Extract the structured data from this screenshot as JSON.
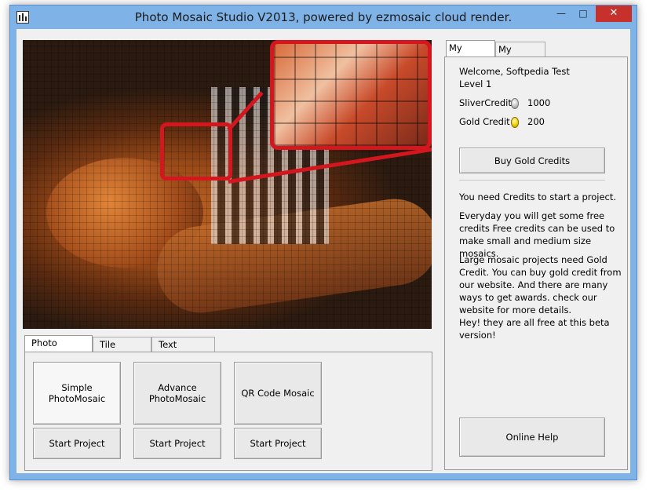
{
  "window": {
    "title": "Photo Mosaic Studio V2013, powered by ezmosaic cloud render.",
    "controls": {
      "minimize": "—",
      "maximize": "□",
      "close": "✕"
    }
  },
  "mosaic_tabs": [
    "Photo Mosaic",
    "Tile Mosaic",
    "Text Mosaic"
  ],
  "mosaic_options": [
    {
      "label": "Simple PhotoMosaic",
      "start": "Start Project"
    },
    {
      "label": "Advance PhotoMosaic",
      "start": "Start Project"
    },
    {
      "label": "QR Code Mosaic",
      "start": "Start Project"
    }
  ],
  "account_tabs": [
    "My account",
    "My Projects"
  ],
  "account": {
    "welcome": "Welcome, Softpedia Test",
    "level": "Level 1",
    "silver_label": "SliverCredit",
    "silver_value": "1000",
    "gold_label": "Gold Credit",
    "gold_value": "200",
    "buy_button": "Buy Gold Credits",
    "note1": "You need Credits to start a project.",
    "note2": "Everyday you will get some free credits Free credits can be used to make small and medium size mosaics.",
    "note3": "Large mosaic projects need Gold Credit. You can buy gold credit from our website. And there are many ways to get awards. check our website for more details.",
    "note4": "Hey! they are all free at this beta version!",
    "help_button": "Online Help"
  },
  "colors": {
    "title_bar": "#7fb3e8",
    "close_button": "#c7312b",
    "highlight_frame": "#d4161e"
  }
}
